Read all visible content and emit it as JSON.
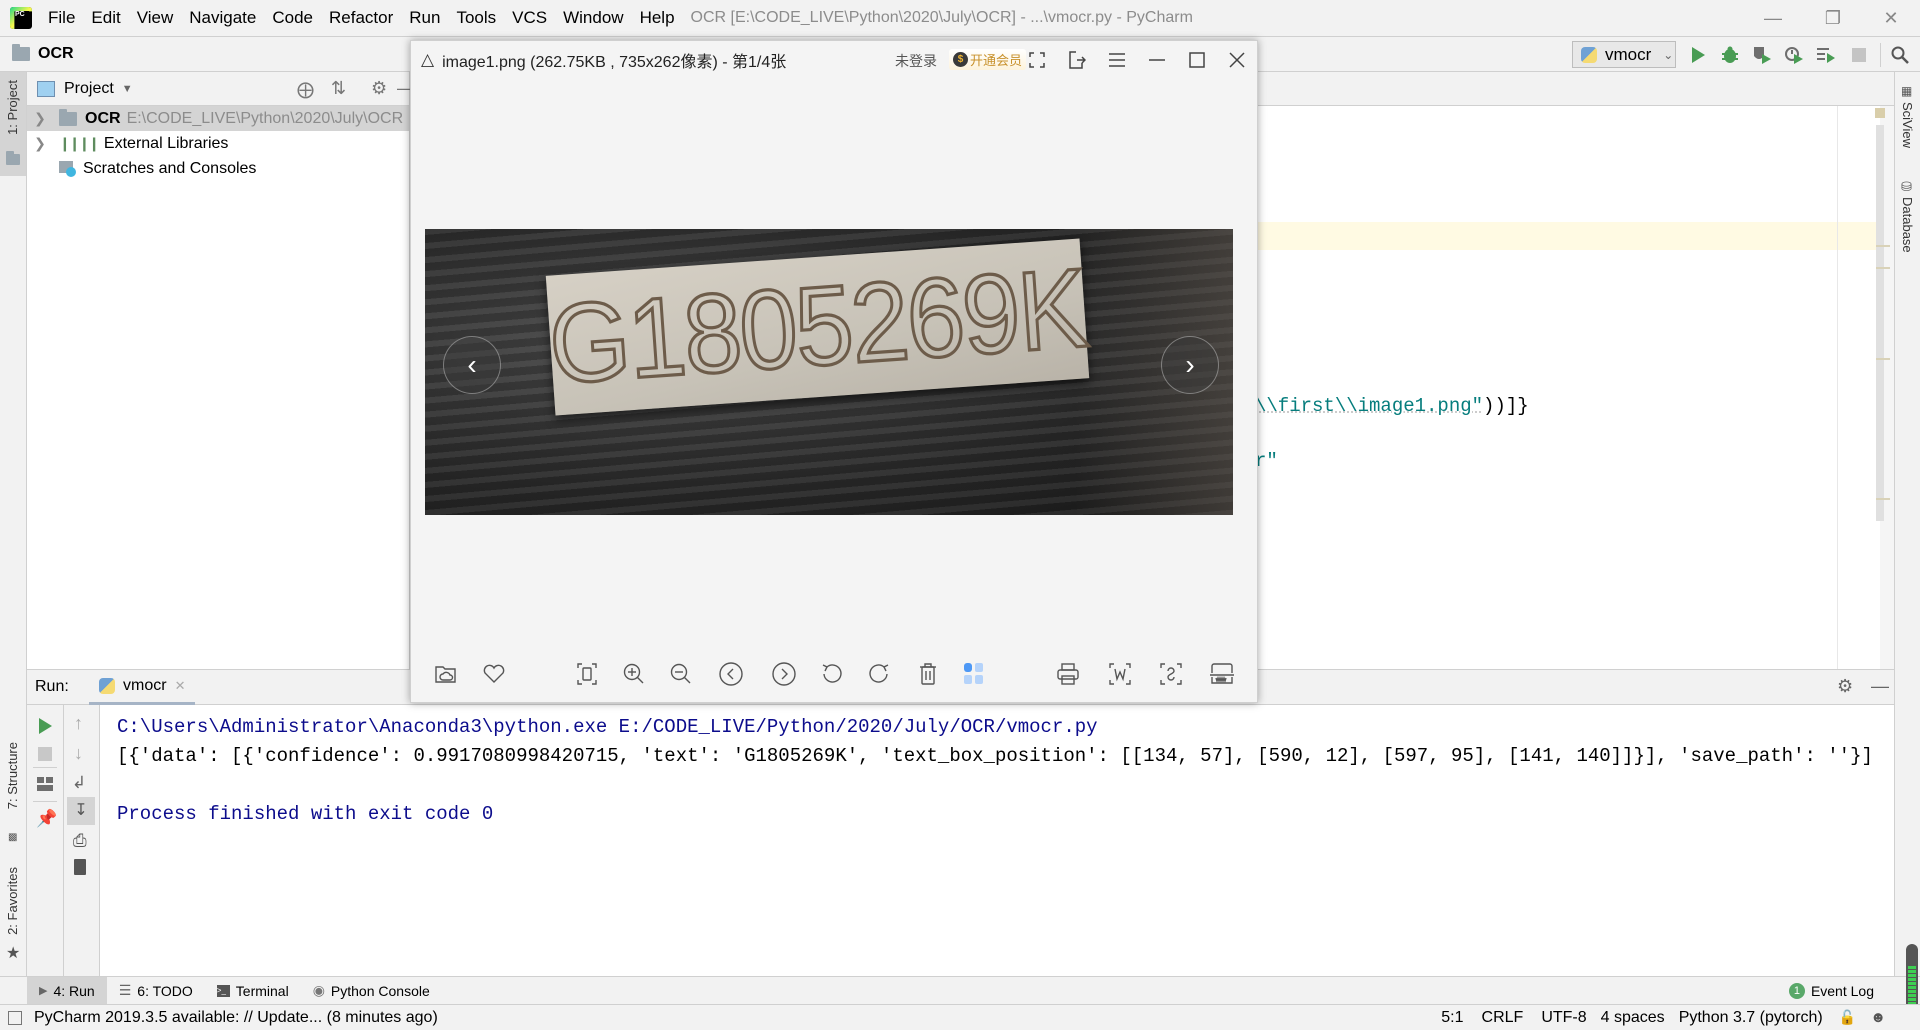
{
  "menubar": {
    "items": [
      "File",
      "Edit",
      "View",
      "Navigate",
      "Code",
      "Refactor",
      "Run",
      "Tools",
      "VCS",
      "Window",
      "Help"
    ],
    "window_title": "OCR [E:\\CODE_LIVE\\Python\\2020\\July\\OCR] - ...\\vmocr.py - PyCharm"
  },
  "navbar": {
    "breadcrumb": "OCR",
    "run_config": "vmocr"
  },
  "left_strip": {
    "project": "1: Project",
    "structure": "7: Structure",
    "favorites": "2: Favorites"
  },
  "right_strip": {
    "sciview": "SciView",
    "database": "Database"
  },
  "project_panel": {
    "header": "Project",
    "tree": [
      {
        "label": "OCR",
        "path": "E:\\CODE_LIVE\\Python\\2020\\July\\OCR"
      },
      {
        "label": "External Libraries"
      },
      {
        "label": "Scratches and Consoles"
      }
    ]
  },
  "editor": {
    "visible_line_1_a": "\\\\first\\\\image1.png\"",
    "visible_line_1_b": "))]}",
    "visible_line_2": "r\""
  },
  "image_viewer": {
    "title": "image1.png (262.75KB , 735x262像素) - 第1/4张",
    "login": "未登录",
    "vip": "开通会员",
    "plate_text": "G1805269K"
  },
  "run_panel": {
    "label": "Run:",
    "tab": "vmocr",
    "lines": [
      "C:\\Users\\Administrator\\Anaconda3\\python.exe E:/CODE_LIVE/Python/2020/July/OCR/vmocr.py",
      "[{'data': [{'confidence': 0.9917080998420715, 'text': 'G1805269K', 'text_box_position': [[134, 57], [590, 12], [597, 95], [141, 140]]}], 'save_path': ''}]",
      "",
      "Process finished with exit code 0"
    ]
  },
  "bottom_tabs": {
    "run": "4: Run",
    "todo": "6: TODO",
    "terminal": "Terminal",
    "python_console": "Python Console",
    "event_log": "Event Log",
    "event_count": "1"
  },
  "status_bar": {
    "message": "PyCharm 2019.3.5 available: // Update... (8 minutes ago)",
    "position": "5:1",
    "line_sep": "CRLF",
    "encoding": "UTF-8",
    "indent": "4 spaces",
    "interpreter": "Python 3.7 (pytorch)"
  }
}
